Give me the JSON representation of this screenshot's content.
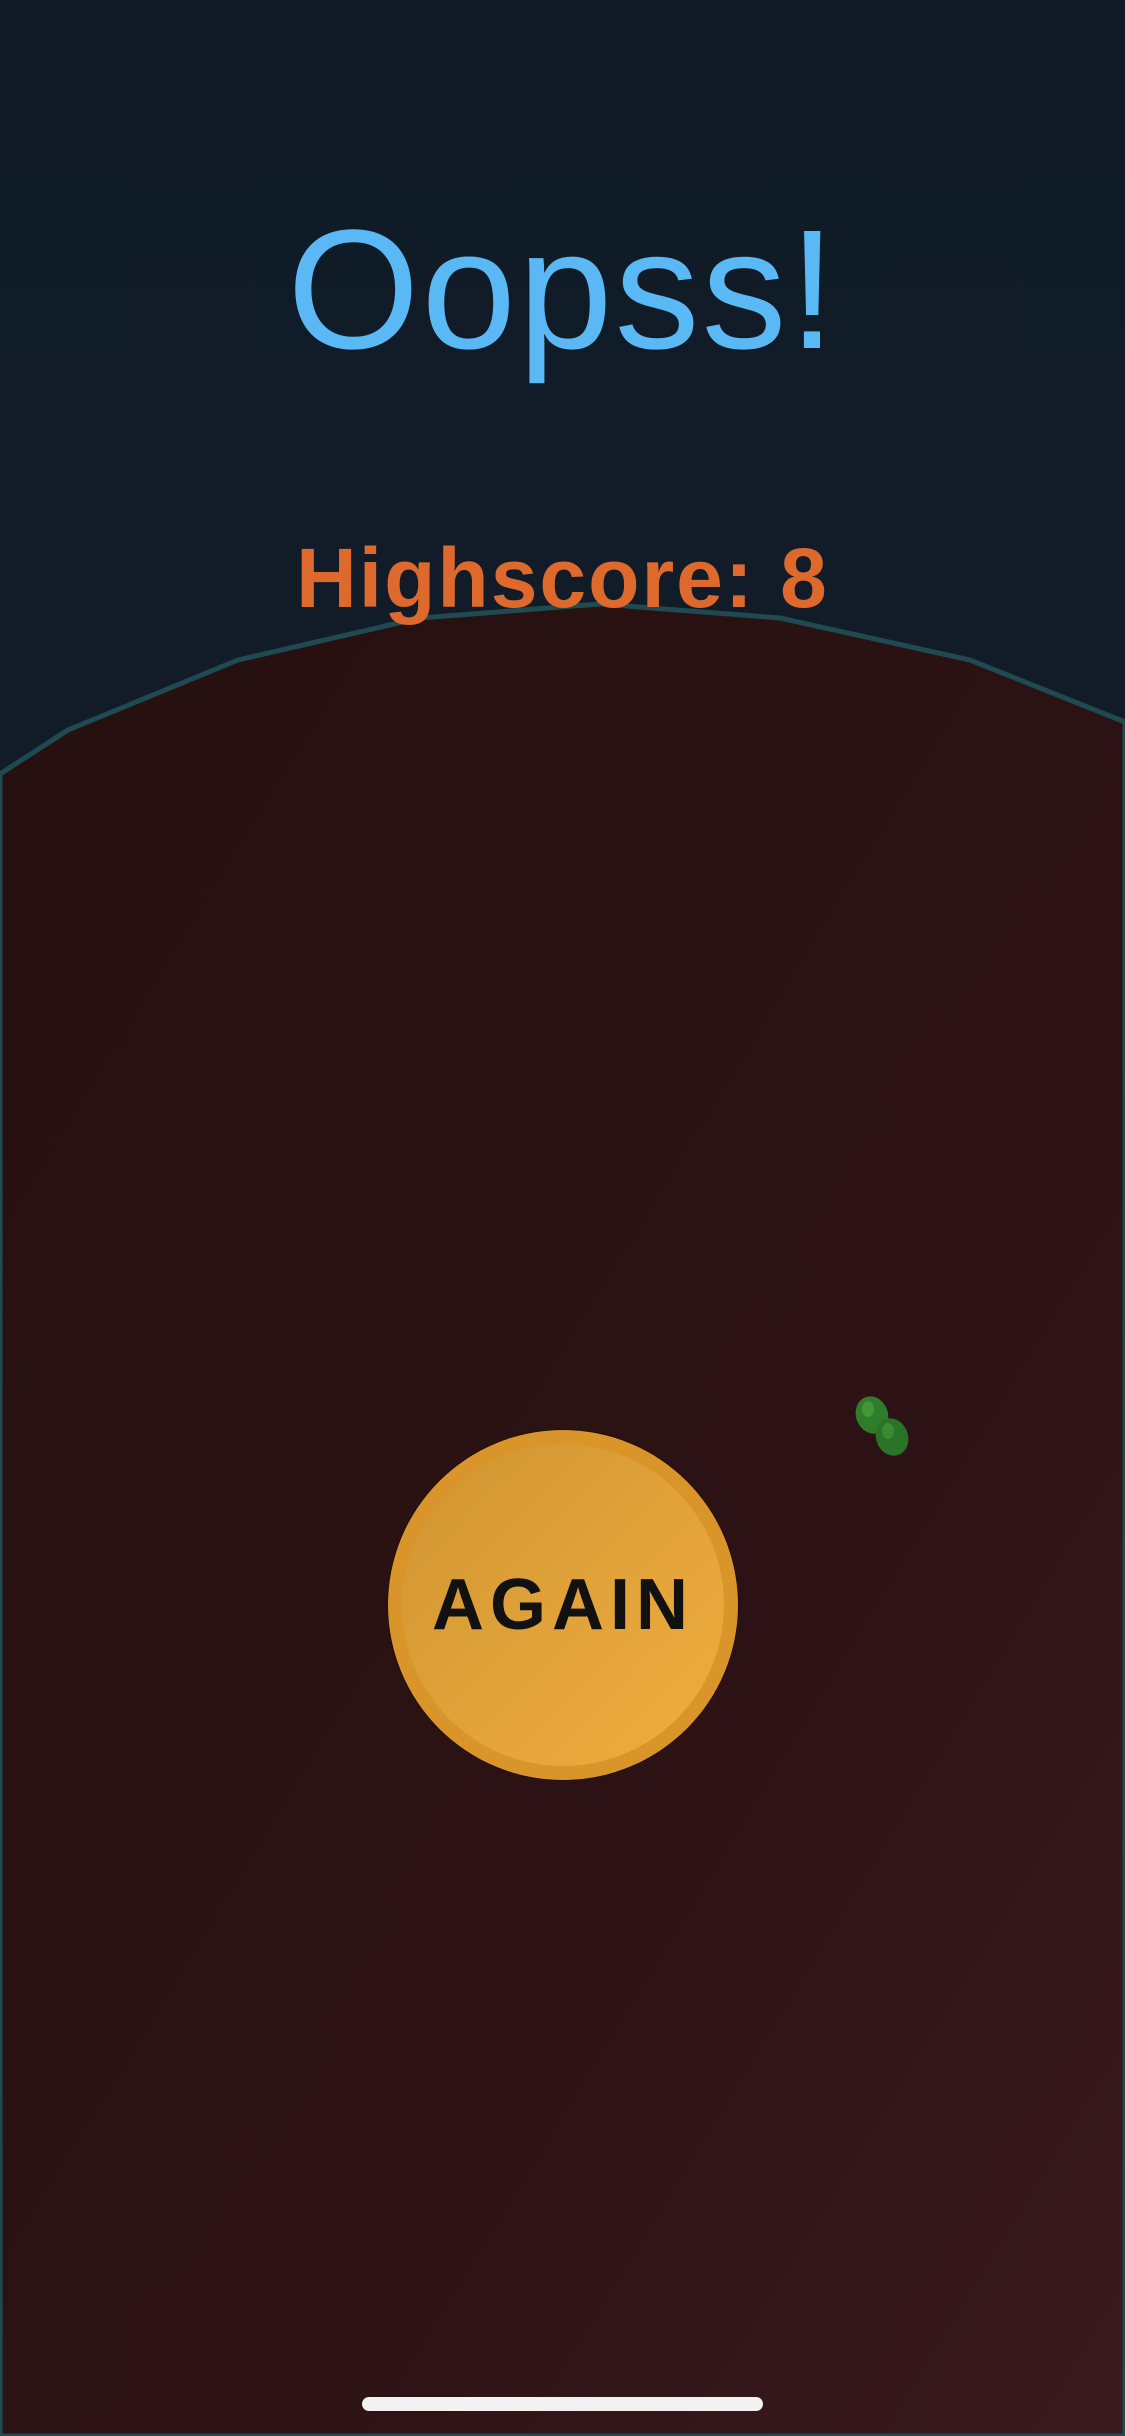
{
  "title": "Oopss!",
  "highscore_text": "Highscore: 8",
  "again_button_label": "AGAIN",
  "colors": {
    "background": "#111b27",
    "planet": "#2a1114",
    "planet_outline": "#1f4a52",
    "title": "#5ab8f4",
    "highscore": "#dd6a2c",
    "button": "#e2a33a",
    "player": "#2f7d2b"
  },
  "icons": {
    "player": "green-blob-icon"
  }
}
